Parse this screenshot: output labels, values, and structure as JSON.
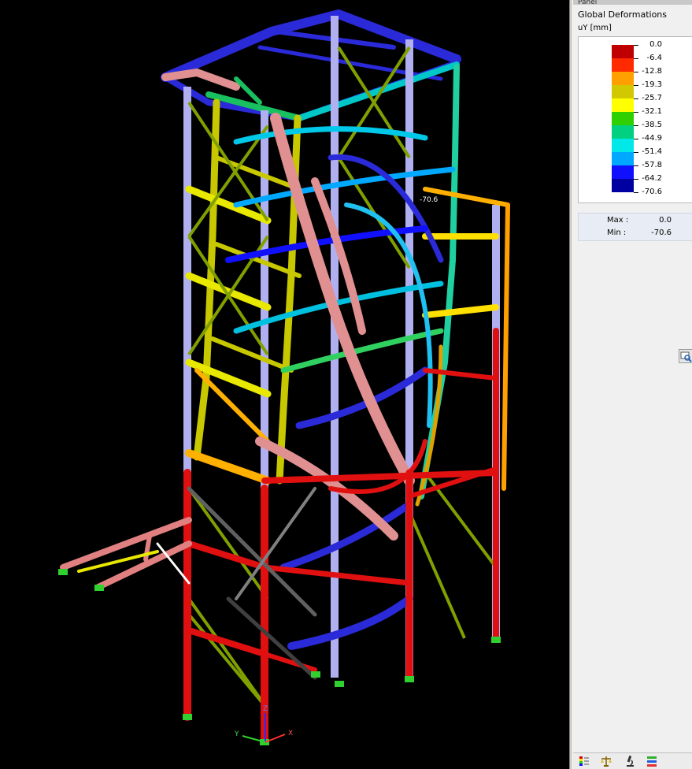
{
  "panel": {
    "header": "Panel",
    "result_title": "Global Deformations",
    "result_unit": "uY [mm]",
    "legend": [
      {
        "value": "0.0",
        "color": "#c00000"
      },
      {
        "value": "-6.4",
        "color": "#e00000"
      },
      {
        "value": "-12.8",
        "color": "#ff2a00"
      },
      {
        "value": "-19.3",
        "color": "#ffa000"
      },
      {
        "value": "-25.7",
        "color": "#d2c800"
      },
      {
        "value": "-32.1",
        "color": "#ffff00"
      },
      {
        "value": "-38.5",
        "color": "#30d000"
      },
      {
        "value": "-44.9",
        "color": "#00d080"
      },
      {
        "value": "-51.4",
        "color": "#00e8e8"
      },
      {
        "value": "-57.8",
        "color": "#00a8ff"
      },
      {
        "value": "-64.2",
        "color": "#1010ff"
      },
      {
        "value": "-70.6",
        "color": "#0000a0"
      }
    ],
    "max_label": "Max",
    "max_value": "0.0",
    "min_label": "Min",
    "min_value": "-70.6"
  },
  "viewport": {
    "value_label": "-70.6",
    "axis_x": "X",
    "axis_y": "Y",
    "axis_z": "Z"
  },
  "toolbar": {
    "icons": [
      "color-scale-icon",
      "balance-scale-icon",
      "microscope-icon",
      "result-bars-icon"
    ]
  }
}
